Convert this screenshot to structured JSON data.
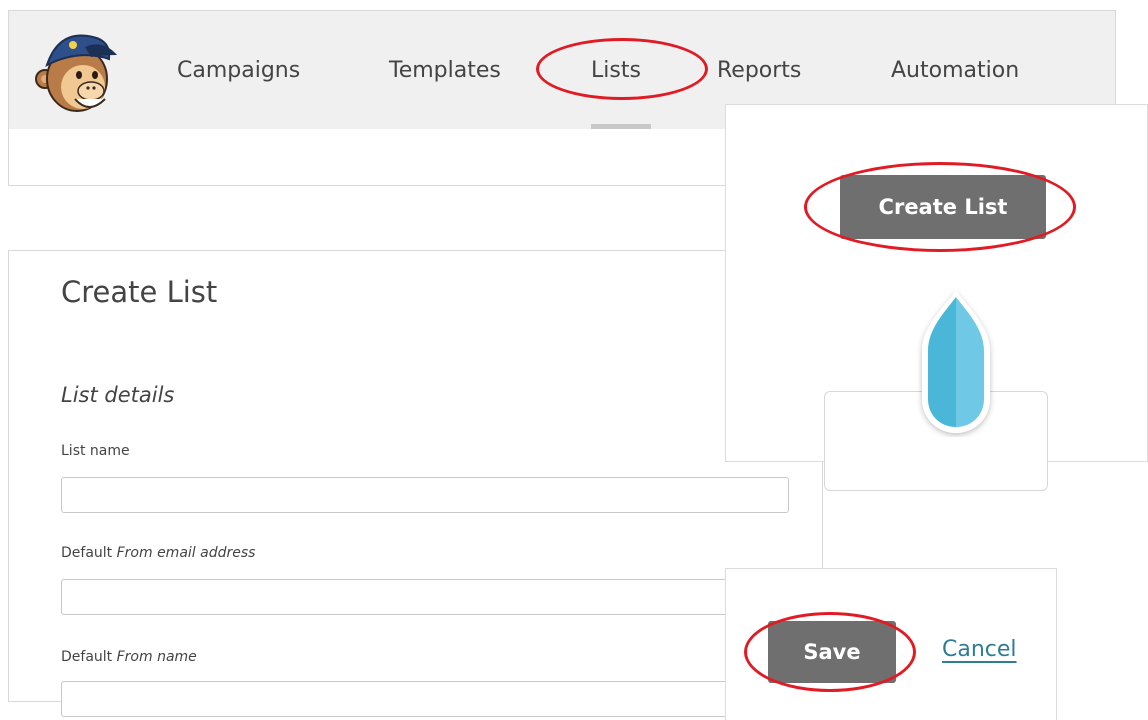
{
  "nav": {
    "items": [
      {
        "label": "Campaigns"
      },
      {
        "label": "Templates"
      },
      {
        "label": "Lists"
      },
      {
        "label": "Reports"
      },
      {
        "label": "Automation"
      }
    ],
    "active": "Lists"
  },
  "form": {
    "title": "Create List",
    "section_title": "List details",
    "fields": {
      "list_name": {
        "label": "List name",
        "value": ""
      },
      "from_email": {
        "label_prefix": "Default ",
        "label_em": "From email address",
        "value": ""
      },
      "from_name": {
        "label_prefix": "Default ",
        "label_em": "From name",
        "value": ""
      }
    }
  },
  "callouts": {
    "create_button_label": "Create List",
    "save_button_label": "Save",
    "cancel_link_label": "Cancel"
  },
  "colors": {
    "highlight": "#e01b24",
    "button": "#6f6f6f",
    "link": "#2f7d95",
    "nav_background": "#f0f0f0",
    "drop_icon": "#4ab6d8"
  }
}
